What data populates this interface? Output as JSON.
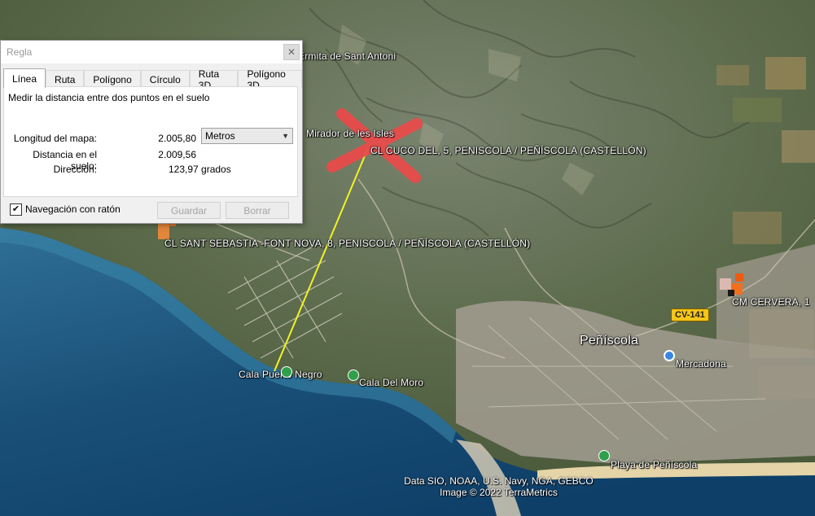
{
  "map": {
    "labels": {
      "ermita": "Ermita de Sant Antoni",
      "mirador": "Mirador de les Isles",
      "cuco": "CL CUCO DEL, 5, PENISCOLA / PEÑÍSCOLA (CASTELLÓN)",
      "sant_sebastia": "CL SANT SEBASTIA -FONT NOVA, 8, PENISCOLA / PEÑÍSCOLA (CASTELLÓN)",
      "cervera": "CM CERVERA, 1",
      "peniscola": "Peñíscola",
      "mercadona": "Mercadona",
      "cala_puerto_negro": "Cala Puerto Negro",
      "cala_del_moro": "Cala Del Moro",
      "playa": "Playa de Peñíscola"
    },
    "road_shield": "CV-141",
    "copyright_line1": "Data SIO, NOAA, U.S. Navy, NGA, GEBCO",
    "copyright_line2": "Image © 2022 TerraMetrics",
    "colors": {
      "sea_deep": "#0e3f68",
      "sea_shallow": "#2f6f96",
      "land": "#4a5a3a",
      "hills": "#6b7560",
      "measure_line": "#f2f226",
      "red_x": "#ec4a4a"
    }
  },
  "dialog": {
    "title": "Regla",
    "close_icon": "close-icon",
    "tabs": [
      "Línea",
      "Ruta",
      "Polígono",
      "Círculo",
      "Ruta 3D",
      "Polígono 3D"
    ],
    "active_tab": "Línea",
    "description": "Medir la distancia entre dos puntos en el suelo",
    "map_length_label": "Longitud del mapa:",
    "map_length_value": "2.005,80",
    "unit_select": "Metros",
    "ground_distance_label": "Distancia en el suelo:",
    "ground_distance_value": "2.009,56",
    "heading_label": "Dirección:",
    "heading_value": "123,97 grados",
    "mouse_nav_label": "Navegación con ratón",
    "mouse_nav_checked": true,
    "save_label": "Guardar",
    "clear_label": "Borrar"
  }
}
